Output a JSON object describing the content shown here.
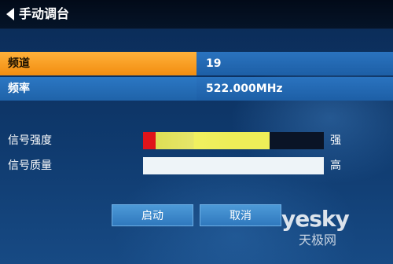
{
  "header": {
    "title": "手动调台",
    "back_icon": "chevron-left-icon"
  },
  "rows": [
    {
      "label": "频道",
      "value": "19",
      "selected": true
    },
    {
      "label": "频率",
      "value": "522.000MHz",
      "selected": false
    }
  ],
  "signal": {
    "strength": {
      "label": "信号强度",
      "level": "强",
      "fill_fraction": 0.7
    },
    "quality": {
      "label": "信号质量",
      "level": "高",
      "fill_fraction": 1.0
    }
  },
  "buttons": {
    "start": "启动",
    "cancel": "取消"
  },
  "watermark": {
    "brand": "yesky",
    "cn": "天极网"
  },
  "colors": {
    "selected": "#f59a1c",
    "row": "#2068b0",
    "strength_low": "#e0141a",
    "strength_high": "#eeee58",
    "quality": "#eef4f8"
  }
}
